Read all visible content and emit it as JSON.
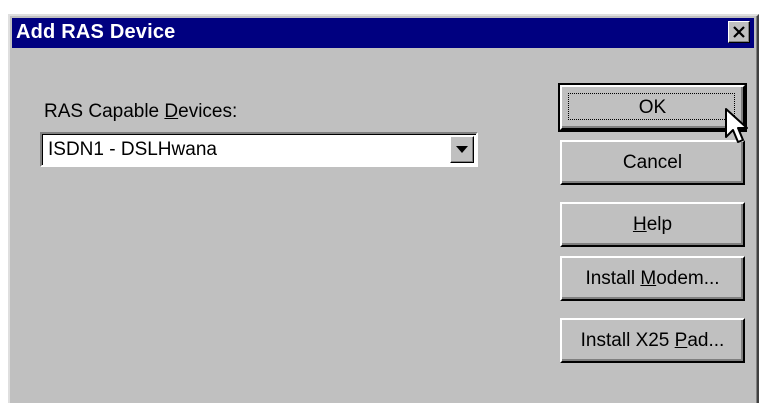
{
  "window": {
    "title": "Add RAS Device",
    "close_icon": "close-icon"
  },
  "devices_label": {
    "before": "RAS Capable ",
    "mnemonic": "D",
    "after": "evices:"
  },
  "devices_combo": {
    "selected": "ISDN1 - DSLHwana",
    "arrow_icon": "chevron-down-icon"
  },
  "buttons": {
    "ok": "OK",
    "cancel": "Cancel",
    "help": {
      "before": "",
      "mnemonic": "H",
      "after": "elp"
    },
    "install_modem": {
      "before": "Install ",
      "mnemonic": "M",
      "after": "odem..."
    },
    "install_x25": {
      "before": "Install X25 ",
      "mnemonic": "P",
      "after": "ad..."
    }
  },
  "colors": {
    "titlebar": "#000080",
    "face": "#c0c0c0"
  }
}
